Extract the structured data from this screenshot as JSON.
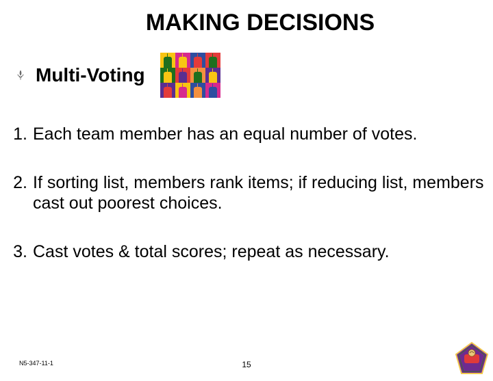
{
  "title": "MAKING DECISIONS",
  "subtitle": "Multi-Voting",
  "hands_grid": [
    {
      "bg": "#f8c513",
      "hand": "#1e6f1e"
    },
    {
      "bg": "#d62a8e",
      "hand": "#f8c513"
    },
    {
      "bg": "#2e4ea0",
      "hand": "#e33b3b"
    },
    {
      "bg": "#e33b3b",
      "hand": "#1e6f1e"
    },
    {
      "bg": "#1e6f1e",
      "hand": "#f8c513"
    },
    {
      "bg": "#e33b3b",
      "hand": "#5a2e91"
    },
    {
      "bg": "#f3903f",
      "hand": "#1e6f1e"
    },
    {
      "bg": "#5a2e91",
      "hand": "#f8c513"
    },
    {
      "bg": "#5a2e91",
      "hand": "#e33b3b"
    },
    {
      "bg": "#f8c513",
      "hand": "#d62a8e"
    },
    {
      "bg": "#2e4ea0",
      "hand": "#f3903f"
    },
    {
      "bg": "#d62a8e",
      "hand": "#2e4ea0"
    }
  ],
  "items": [
    {
      "num": "1.",
      "text": "Each team member has an equal number of votes."
    },
    {
      "num": "2.",
      "text": "If sorting list, members rank items; if reducing list, members cast out poorest choices."
    },
    {
      "num": "3.",
      "text": "Cast votes & total  scores; repeat as necessary."
    }
  ],
  "footer_code": "N5-347-11-1",
  "page_number": "15",
  "badge": {
    "pent_fill": "#6e2b8f",
    "pent_border": "#f1c84c",
    "plaque_fill": "#e03a3a"
  }
}
